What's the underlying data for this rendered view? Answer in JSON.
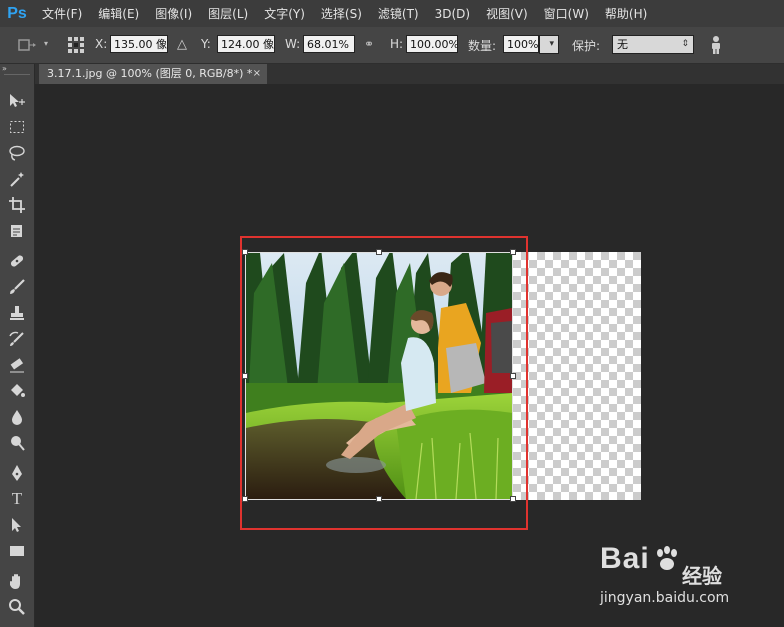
{
  "app": {
    "logo": "Ps"
  },
  "menu": [
    "文件(F)",
    "编辑(E)",
    "图像(I)",
    "图层(L)",
    "文字(Y)",
    "选择(S)",
    "滤镜(T)",
    "3D(D)",
    "视图(V)",
    "窗口(W)",
    "帮助(H)"
  ],
  "options": {
    "x_label": "X:",
    "x_value": "135.00 像",
    "y_label": "Y:",
    "y_value": "124.00 像",
    "w_label": "W:",
    "w_value": "68.01%",
    "h_label": "H:",
    "h_value": "100.00%",
    "amount_label": "数量:",
    "amount_value": "100%",
    "protect_label": "保护:",
    "protect_value": "无"
  },
  "document": {
    "tab_title": "3.17.1.jpg @ 100% (图层 0, RGB/8*) *",
    "close": "×"
  },
  "watermark": {
    "brand": "Bai",
    "brand_suffix": "经验",
    "url": "jingyan.baidu.com"
  },
  "colors": {
    "selection": "#e0332f",
    "accent": "#2fa3f2"
  }
}
